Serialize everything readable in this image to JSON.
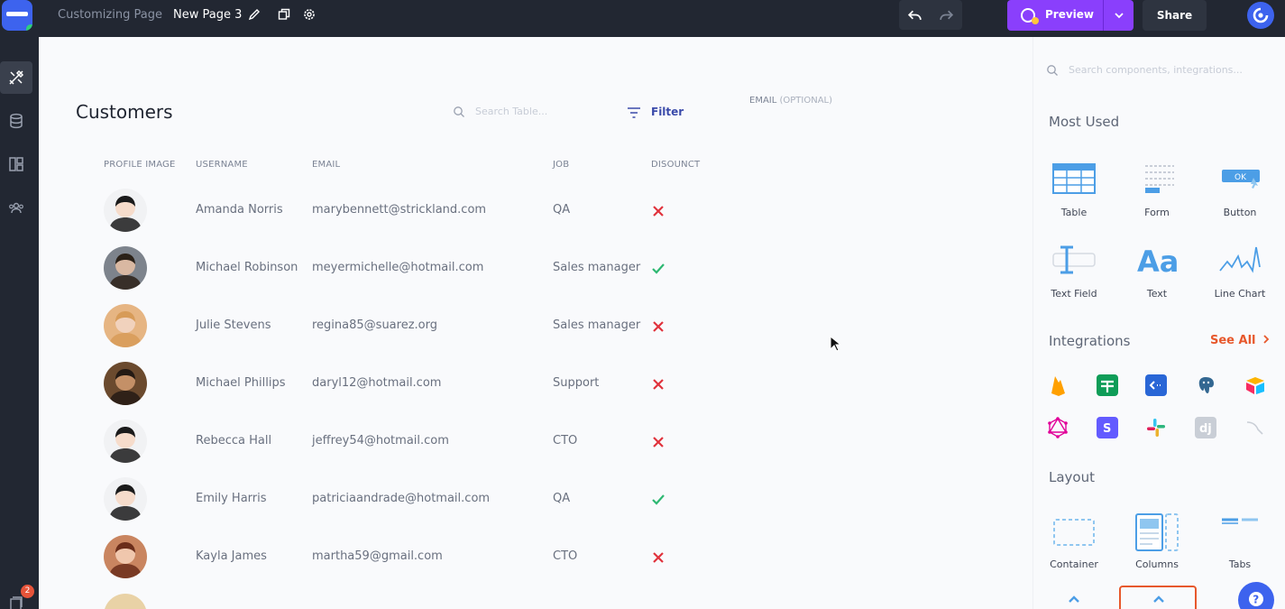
{
  "topbar": {
    "app_name": "Customizing Page",
    "page_name": "New Page 3",
    "preview_label": "Preview",
    "share_label": "Share"
  },
  "sidebar": {
    "notification_count": "2"
  },
  "table": {
    "title": "Customers",
    "search_placeholder": "Search Table...",
    "filter_label": "Filter",
    "email_field_label": "EMAIL",
    "email_field_optional": "(OPTIONAL)",
    "columns": [
      "PROFILE IMAGE",
      "USERNAME",
      "EMAIL",
      "JOB",
      "DISOUNCT"
    ],
    "rows": [
      {
        "username": "Amanda Norris",
        "email": "marybennett@strickland.com",
        "job": "QA",
        "discount": false
      },
      {
        "username": "Michael Robinson",
        "email": "meyermichelle@hotmail.com",
        "job": "Sales manager",
        "discount": true
      },
      {
        "username": "Julie Stevens",
        "email": "regina85@suarez.org",
        "job": "Sales manager",
        "discount": false
      },
      {
        "username": "Michael Phillips",
        "email": "daryl12@hotmail.com",
        "job": "Support",
        "discount": false
      },
      {
        "username": "Rebecca Hall",
        "email": "jeffrey54@hotmail.com",
        "job": "CTO",
        "discount": false
      },
      {
        "username": "Emily Harris",
        "email": "patriciaandrade@hotmail.com",
        "job": "QA",
        "discount": true
      },
      {
        "username": "Kayla James",
        "email": "martha59@gmail.com",
        "job": "CTO",
        "discount": false
      }
    ]
  },
  "panel": {
    "search_placeholder": "Search components, integrations...",
    "most_used_title": "Most Used",
    "most_used": [
      "Table",
      "Form",
      "Button",
      "Text Field",
      "Text",
      "Line Chart"
    ],
    "integrations_title": "Integrations",
    "see_all_label": "See All",
    "layout_title": "Layout",
    "layout": [
      "Container",
      "Columns",
      "Tabs"
    ]
  },
  "colors": {
    "accent": "#8a3ffc",
    "brand": "#3d63ee",
    "danger": "#e0323c",
    "success": "#2eb872",
    "link": "#e7582c"
  }
}
